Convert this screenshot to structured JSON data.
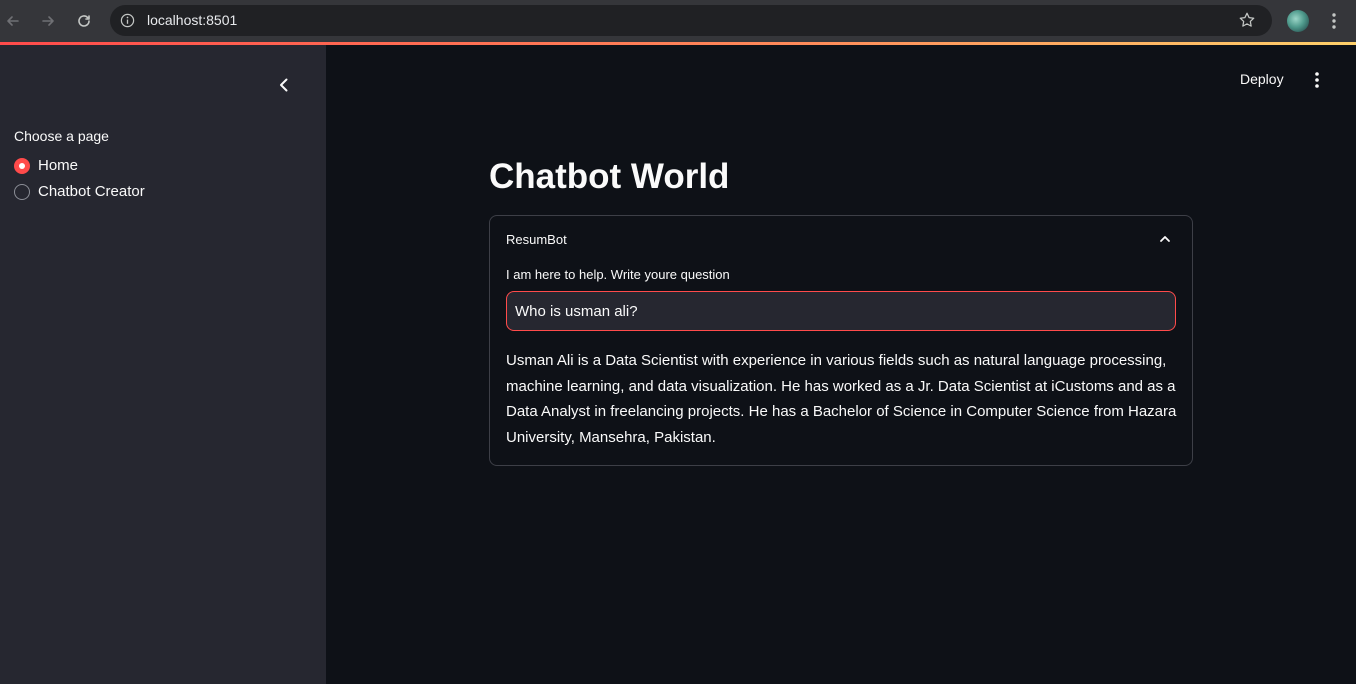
{
  "browser": {
    "url": "localhost:8501"
  },
  "sidebar": {
    "radio_label": "Choose a page",
    "options": [
      {
        "label": "Home",
        "selected": true
      },
      {
        "label": "Chatbot Creator",
        "selected": false
      }
    ]
  },
  "header": {
    "deploy_label": "Deploy"
  },
  "main": {
    "title": "Chatbot World",
    "expander": {
      "title": "ResumBot",
      "input_label": "I am here to help. Write youre question",
      "input_value": "Who is usman ali?",
      "answer": "Usman Ali is a Data Scientist with experience in various fields such as natural language processing, machine learning, and data visualization. He has worked as a Jr. Data Scientist at iCustoms and as a Data Analyst in freelancing projects. He has a Bachelor of Science in Computer Science from Hazara University, Mansehra, Pakistan."
    }
  },
  "colors": {
    "accent": "#ff4b4b",
    "sidebar_bg": "#262730",
    "main_bg": "#0e1117"
  },
  "icons": [
    "back-arrow-icon",
    "forward-arrow-icon",
    "reload-icon",
    "site-info-icon",
    "bookmark-star-icon",
    "profile-avatar",
    "chrome-menu-icon",
    "sidebar-collapse-icon",
    "main-menu-icon",
    "chevron-up-icon"
  ]
}
